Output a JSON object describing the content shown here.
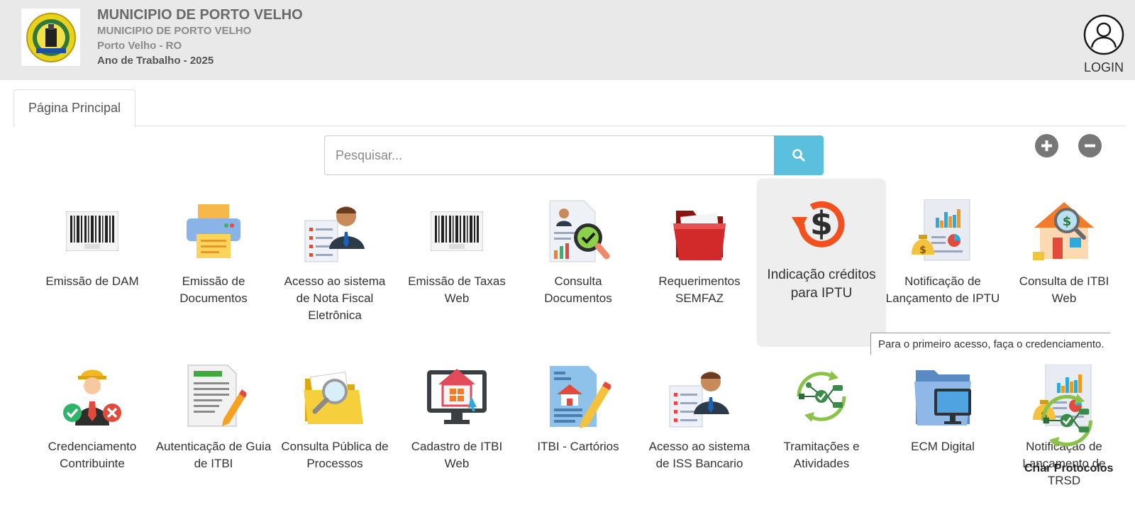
{
  "header": {
    "title": "MUNICIPIO DE PORTO VELHO",
    "subtitle": "MUNICIPIO DE PORTO VELHO",
    "location": "Porto Velho - RO",
    "work_year": "Ano de Trabalho - 2025",
    "login_label": "LOGIN"
  },
  "tabs": [
    {
      "label": "Página Principal"
    }
  ],
  "search": {
    "placeholder": "Pesquisar...",
    "value": ""
  },
  "tooltip": "Para o primeiro acesso, faça o credenciamento.",
  "overlay_label": "Criar Protocolos",
  "services": [
    {
      "label": "Emissão de DAM",
      "icon": "barcode-icon"
    },
    {
      "label": "Emissão de Documentos",
      "icon": "printer-icon"
    },
    {
      "label": "Acesso ao sistema de Nota Fiscal Eletrônica",
      "icon": "person-document-icon"
    },
    {
      "label": "Emissão de Taxas Web",
      "icon": "barcode-icon"
    },
    {
      "label": "Consulta Documentos",
      "icon": "document-check-icon"
    },
    {
      "label": "Requerimentos SEMFAZ",
      "icon": "red-folder-icon"
    },
    {
      "label": "Indicação créditos para IPTU",
      "icon": "dollar-refresh-icon"
    },
    {
      "label": "Notificação de Lançamento de IPTU",
      "icon": "money-report-icon"
    },
    {
      "label": "Consulta de ITBI Web",
      "icon": "house-search-icon"
    },
    {
      "label": "Credenciamento Contribuinte",
      "icon": "person-approve-reject-icon"
    },
    {
      "label": "Autenticação de Guia de ITBI",
      "icon": "document-pencil-icon"
    },
    {
      "label": "Consulta Pública de Processos",
      "icon": "folder-magnifier-icon"
    },
    {
      "label": "Cadastro de ITBI Web",
      "icon": "house-monitor-icon"
    },
    {
      "label": "ITBI - Cartórios",
      "icon": "house-document-pencil-icon"
    },
    {
      "label": "Acesso ao sistema de ISS Bancario",
      "icon": "person-document-icon"
    },
    {
      "label": "Tramitações e Atividades",
      "icon": "workflow-cycle-icon"
    },
    {
      "label": "ECM Digital",
      "icon": "folder-computer-icon"
    },
    {
      "label": "Notificação de Lançamento de TRSD",
      "icon": "money-report-icon"
    }
  ],
  "colors": {
    "search_button": "#5bc0de",
    "header_bg": "#e9e9e9",
    "highlight_bg": "#eeeeee"
  }
}
